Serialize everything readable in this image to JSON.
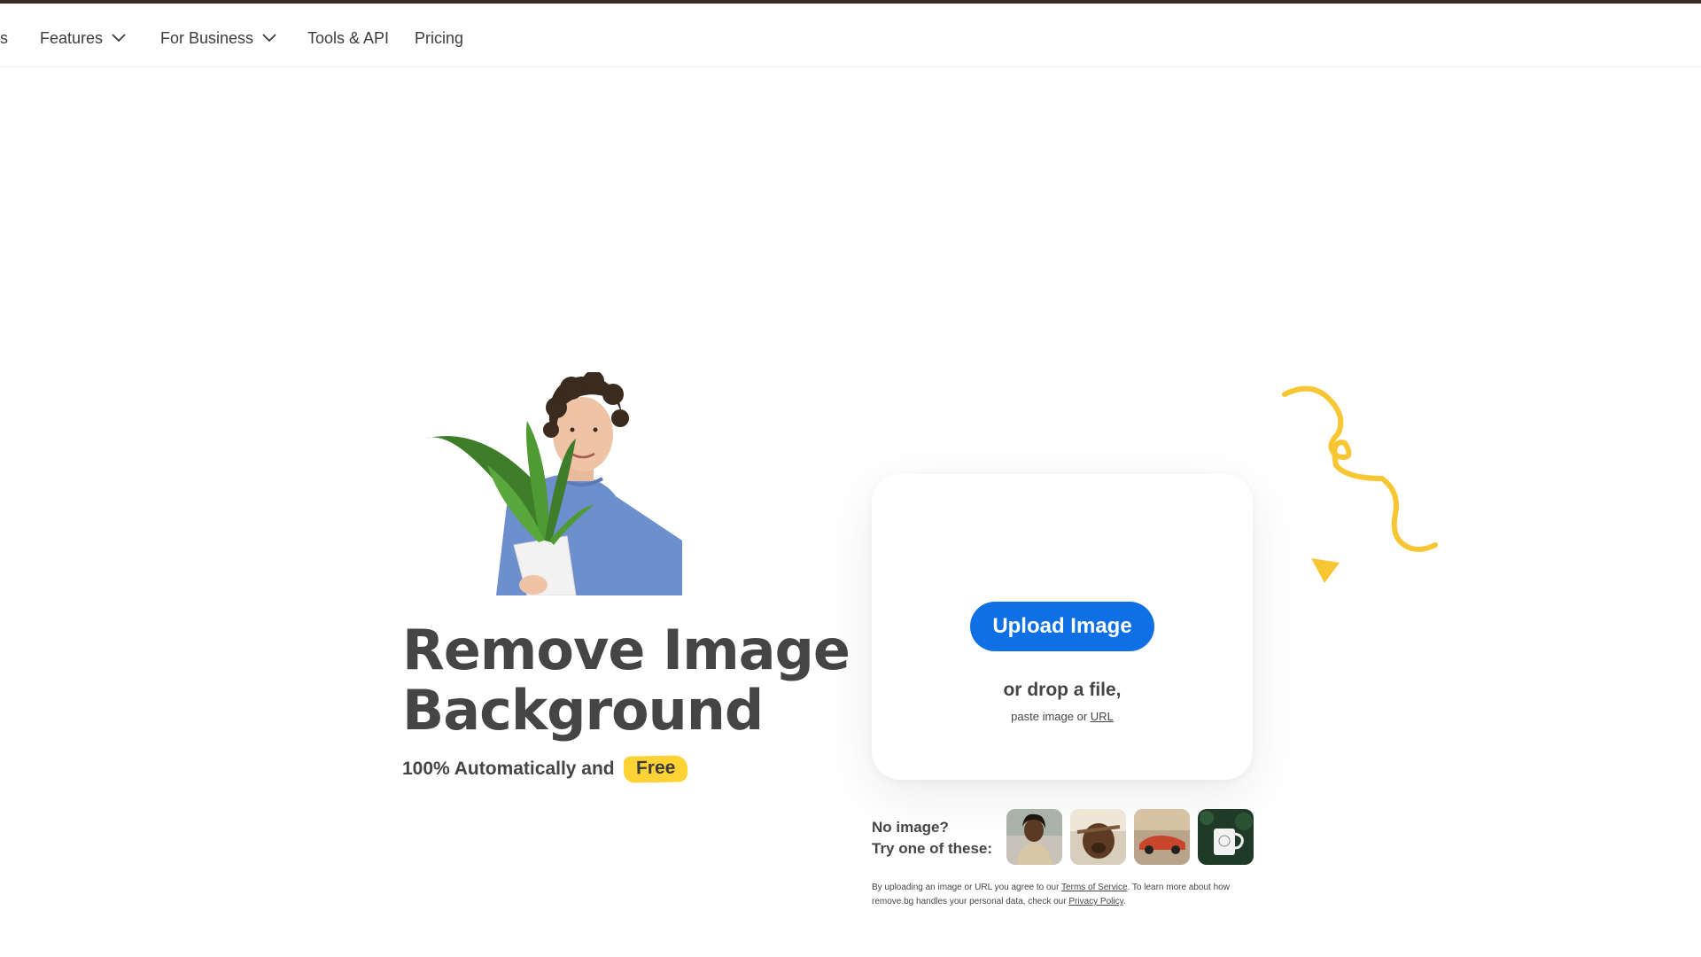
{
  "nav": {
    "clipped_item": "s",
    "items": [
      {
        "label": "Features",
        "has_dropdown": true
      },
      {
        "label": "For Business",
        "has_dropdown": true
      },
      {
        "label": "Tools & API",
        "has_dropdown": false
      },
      {
        "label": "Pricing",
        "has_dropdown": false
      }
    ]
  },
  "hero": {
    "title_line1": "Remove Image",
    "title_line2": "Background",
    "subtitle": "100% Automatically and",
    "badge": "Free",
    "badge_color": "#ffd335"
  },
  "upload": {
    "button_label": "Upload Image",
    "button_color": "#0f70e6",
    "drop_text": "or drop a file,",
    "paste_prefix": "paste image or",
    "paste_link": "URL"
  },
  "samples": {
    "line1": "No image?",
    "line2": "Try one of these:",
    "thumbnails": [
      "woman-photo",
      "dog-photo",
      "car-photo",
      "mug-photo"
    ]
  },
  "legal": {
    "part1": "By uploading an image or URL you agree to our",
    "terms_link": "Terms of Service",
    "part2": ". To learn more about how remove.bg handles your personal data, check our",
    "privacy_link": "Privacy Policy",
    "part3": "."
  },
  "decor": {
    "squiggle_color": "#f8c533"
  }
}
